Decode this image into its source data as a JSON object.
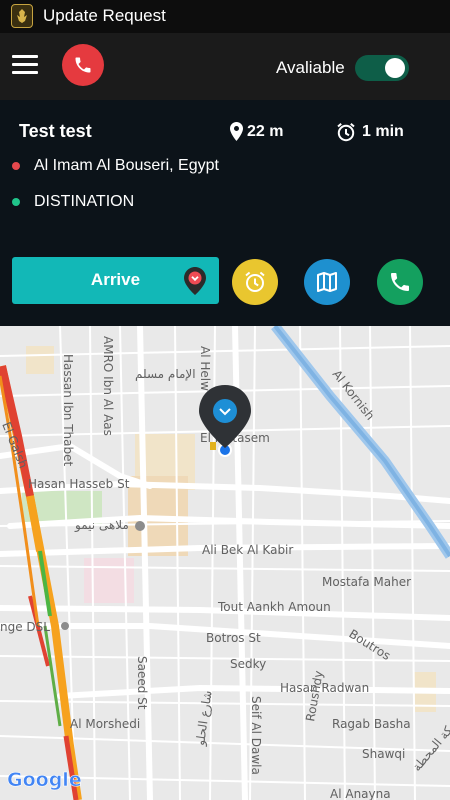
{
  "status_bar": {
    "title": "Update Request"
  },
  "toolbar": {
    "availability_label": "Avaliable",
    "available": true
  },
  "trip": {
    "rider_name": "Test test",
    "distance": "22 m",
    "eta": "1 min",
    "pickup": "Al Imam Al Bouseri, Egypt",
    "destination": "DISTINATION"
  },
  "actions": {
    "arrive_label": "Arrive"
  },
  "map": {
    "streets": [
      "AMRO Ibn Al Aas",
      "Hassan Ibn Thabet",
      "الإمام مسلم",
      "Al Helw",
      "Al Kornish",
      "El Motasem",
      "Hasan Hasseb St",
      "ملاهى نيمو",
      "Ali Bek Al Kabir",
      "Mostafa Maher",
      "Tout Aankh Amoun",
      "nge DSL",
      "Botros St",
      "Sedky",
      "Boutros",
      "Saeed St",
      "Hasan Radwan",
      "Seif Al Dawla",
      "Roushdy",
      "Ragab Basha",
      "Shawqi",
      "Al Morshedi",
      "شارع الحلو",
      "سكة المحطة",
      "Al Anayna",
      "El Galsh"
    ],
    "logo": "Google"
  },
  "colors": {
    "call": "#e53a3f",
    "toggle": "#0e5e48",
    "arrive": "#12b8b7",
    "alarm": "#e9c62f",
    "map_button": "#1e90cf",
    "phone": "#14a05f",
    "pickup_dot": "#e5484d",
    "destination_dot": "#20c48a"
  },
  "icons": [
    "app-logo-icon",
    "menu-icon",
    "phone-icon",
    "location-pin-icon",
    "alarm-clock-icon",
    "map-icon",
    "map-marker-icon",
    "chevron-down-icon"
  ]
}
